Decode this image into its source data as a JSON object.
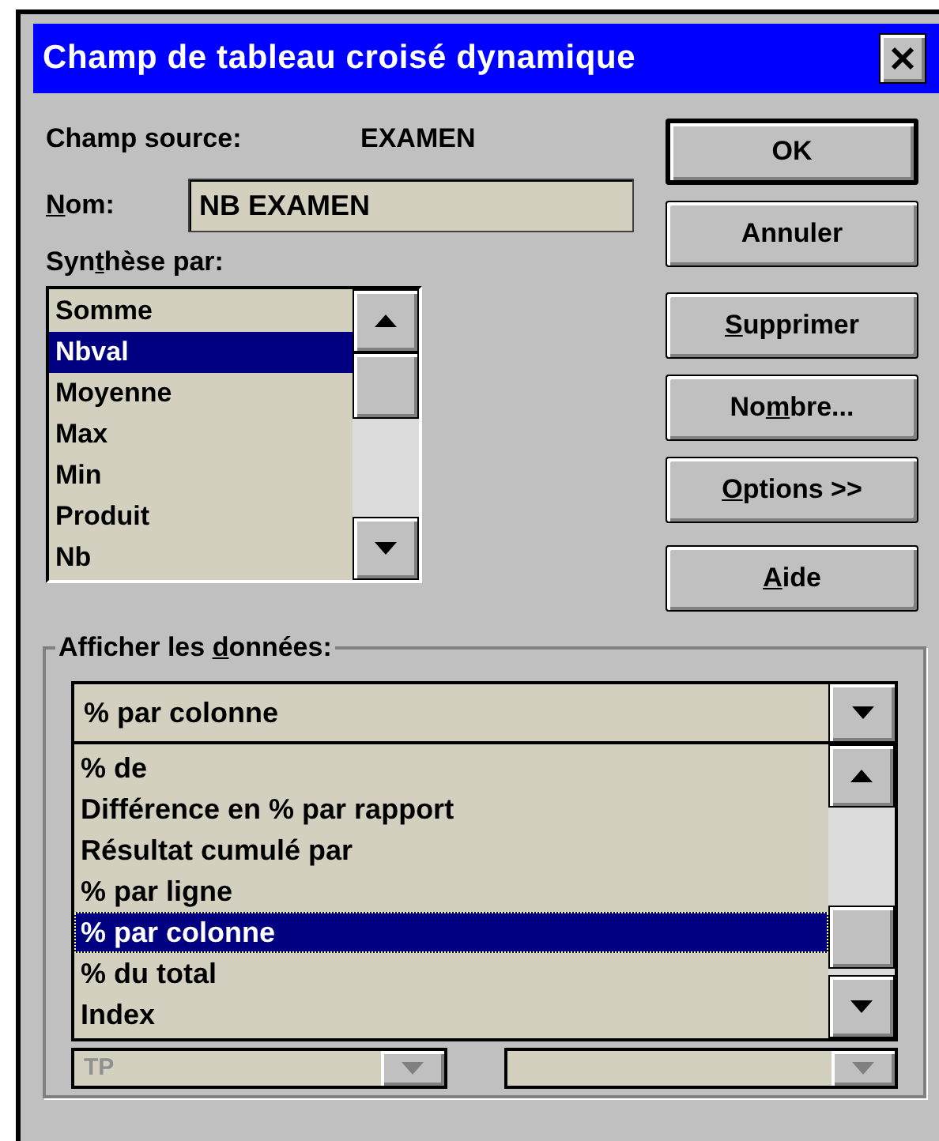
{
  "window": {
    "title": "Champ de tableau croisé dynamique"
  },
  "source": {
    "label": "Champ source:",
    "value": "EXAMEN"
  },
  "name_field": {
    "label": [
      {
        "text": "N",
        "underline": true
      },
      {
        "text": "om:",
        "underline": false
      }
    ],
    "value": "NB EXAMEN"
  },
  "summary": {
    "label": [
      {
        "text": "Syn",
        "underline": false
      },
      {
        "text": "t",
        "underline": true
      },
      {
        "text": "hèse par:",
        "underline": false
      }
    ],
    "items": [
      {
        "label": "Somme",
        "selected": false
      },
      {
        "label": "Nbval",
        "selected": true
      },
      {
        "label": "Moyenne",
        "selected": false
      },
      {
        "label": "Max",
        "selected": false
      },
      {
        "label": "Min",
        "selected": false
      },
      {
        "label": "Produit",
        "selected": false
      },
      {
        "label": "Nb",
        "selected": false
      }
    ]
  },
  "buttons": [
    {
      "label": [
        {
          "text": "OK",
          "underline": false
        }
      ],
      "default": true
    },
    {
      "label": [
        {
          "text": "Annuler",
          "underline": false
        }
      ],
      "default": false
    },
    {
      "label": [
        {
          "text": "S",
          "underline": true
        },
        {
          "text": "upprimer",
          "underline": false
        }
      ],
      "default": false
    },
    {
      "label": [
        {
          "text": "No",
          "underline": false
        },
        {
          "text": "m",
          "underline": true
        },
        {
          "text": "bre...",
          "underline": false
        }
      ],
      "default": false
    },
    {
      "label": [
        {
          "text": "O",
          "underline": true
        },
        {
          "text": "ptions >>",
          "underline": false
        }
      ],
      "default": false
    },
    {
      "label": [
        {
          "text": "A",
          "underline": true
        },
        {
          "text": "ide",
          "underline": false
        }
      ],
      "default": false
    }
  ],
  "display": {
    "label": [
      {
        "text": "Afficher les ",
        "underline": false
      },
      {
        "text": "d",
        "underline": true
      },
      {
        "text": "onnées:",
        "underline": false
      }
    ],
    "value": "% par colonne",
    "expanded": true,
    "options": [
      {
        "label": "% de",
        "selected": false
      },
      {
        "label": "Différence en % par rapport",
        "selected": false
      },
      {
        "label": "Résultat cumulé par",
        "selected": false
      },
      {
        "label": "% par ligne",
        "selected": false
      },
      {
        "label": "% par colonne",
        "selected": true
      },
      {
        "label": "% du total",
        "selected": false
      },
      {
        "label": "Index",
        "selected": false
      }
    ],
    "base_field": {
      "value": "TP",
      "disabled": true
    }
  }
}
